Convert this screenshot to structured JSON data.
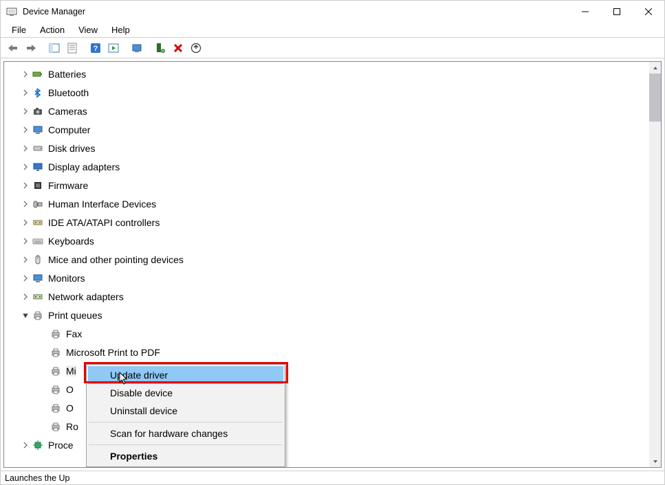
{
  "window": {
    "title": "Device Manager"
  },
  "menu": {
    "items": [
      "File",
      "Action",
      "View",
      "Help"
    ]
  },
  "toolbar": {
    "buttons": [
      "back-icon",
      "forward-icon",
      "|",
      "show-hide-tree-icon",
      "properties-icon",
      "|",
      "help-icon",
      "action-icon",
      "|",
      "scan-hardware-icon",
      "|",
      "add-legacy-icon",
      "uninstall-icon",
      "update-driver-icon"
    ]
  },
  "tree": {
    "categories": [
      {
        "label": "Batteries",
        "icon": "battery",
        "expander": ">"
      },
      {
        "label": "Bluetooth",
        "icon": "bluetooth",
        "expander": ">"
      },
      {
        "label": "Cameras",
        "icon": "camera",
        "expander": ">"
      },
      {
        "label": "Computer",
        "icon": "computer",
        "expander": ">"
      },
      {
        "label": "Disk drives",
        "icon": "disk",
        "expander": ">"
      },
      {
        "label": "Display adapters",
        "icon": "display",
        "expander": ">"
      },
      {
        "label": "Firmware",
        "icon": "firmware",
        "expander": ">"
      },
      {
        "label": "Human Interface Devices",
        "icon": "hid",
        "expander": ">"
      },
      {
        "label": "IDE ATA/ATAPI controllers",
        "icon": "ide",
        "expander": ">"
      },
      {
        "label": "Keyboards",
        "icon": "keyboard",
        "expander": ">"
      },
      {
        "label": "Mice and other pointing devices",
        "icon": "mouse",
        "expander": ">"
      },
      {
        "label": "Monitors",
        "icon": "monitor",
        "expander": ">"
      },
      {
        "label": "Network adapters",
        "icon": "network",
        "expander": ">"
      },
      {
        "label": "Print queues",
        "icon": "printer",
        "expander": "v",
        "children": [
          {
            "label": "Fax",
            "icon": "printer"
          },
          {
            "label": "Microsoft Print to PDF",
            "icon": "printer"
          },
          {
            "label": "Mi",
            "icon": "printer",
            "selected": true,
            "truncated": true
          },
          {
            "label": "O",
            "icon": "printer",
            "truncated": true
          },
          {
            "label": "O",
            "icon": "printer",
            "truncated": true
          },
          {
            "label": "Ro",
            "icon": "printer",
            "truncated": true
          }
        ]
      },
      {
        "label": "Proce",
        "icon": "processor",
        "expander": ">",
        "truncated": true
      }
    ]
  },
  "context_menu": {
    "items": [
      {
        "label": "Update driver",
        "highlighted": true
      },
      {
        "label": "Disable device"
      },
      {
        "label": "Uninstall device"
      },
      {
        "sep": true
      },
      {
        "label": "Scan for hardware changes"
      },
      {
        "sep": true
      },
      {
        "label": "Properties",
        "bold": true
      }
    ]
  },
  "statusbar": {
    "text": "Launches the Up"
  }
}
